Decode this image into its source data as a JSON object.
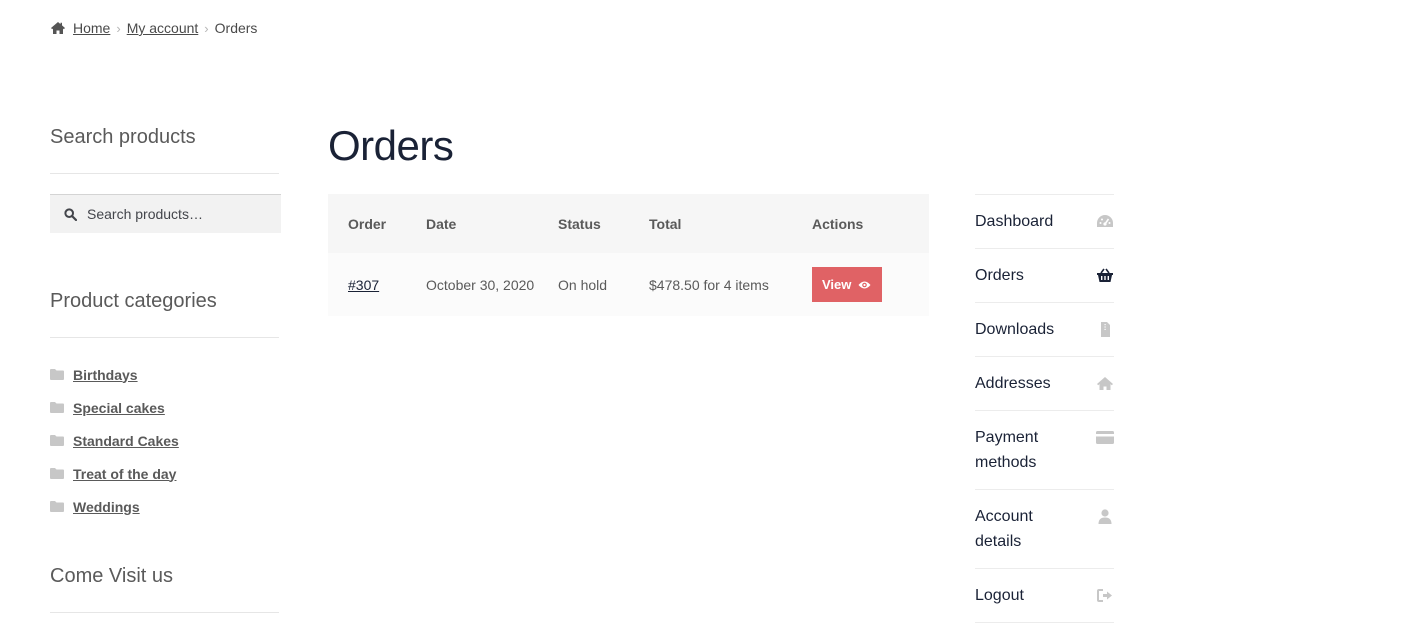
{
  "breadcrumb": {
    "home": "Home",
    "account": "My account",
    "current": "Orders"
  },
  "sidebar": {
    "search_title": "Search products",
    "search_placeholder": "Search products…",
    "categories_title": "Product categories",
    "categories": [
      "Birthdays",
      "Special cakes",
      "Standard Cakes",
      "Treat of the day",
      "Weddings"
    ],
    "visit_title": "Come Visit us"
  },
  "main": {
    "title": "Orders",
    "table": {
      "headers": [
        "Order",
        "Date",
        "Status",
        "Total",
        "Actions"
      ],
      "rows": [
        {
          "order": "#307",
          "date": "October 30, 2020",
          "status": "On hold",
          "total": "$478.50 for 4 items",
          "action": "View"
        }
      ]
    }
  },
  "account_nav": [
    {
      "label": "Dashboard",
      "icon": "dashboard-icon"
    },
    {
      "label": "Orders",
      "icon": "basket-icon"
    },
    {
      "label": "Downloads",
      "icon": "file-icon"
    },
    {
      "label": "Addresses",
      "icon": "home-icon"
    },
    {
      "label": "Payment methods",
      "icon": "credit-card-icon"
    },
    {
      "label": "Account details",
      "icon": "user-icon"
    },
    {
      "label": "Logout",
      "icon": "logout-icon"
    }
  ],
  "colors": {
    "accent_button": "#e06265",
    "heading": "#1a2236",
    "icon_muted": "#c7c7c7"
  }
}
